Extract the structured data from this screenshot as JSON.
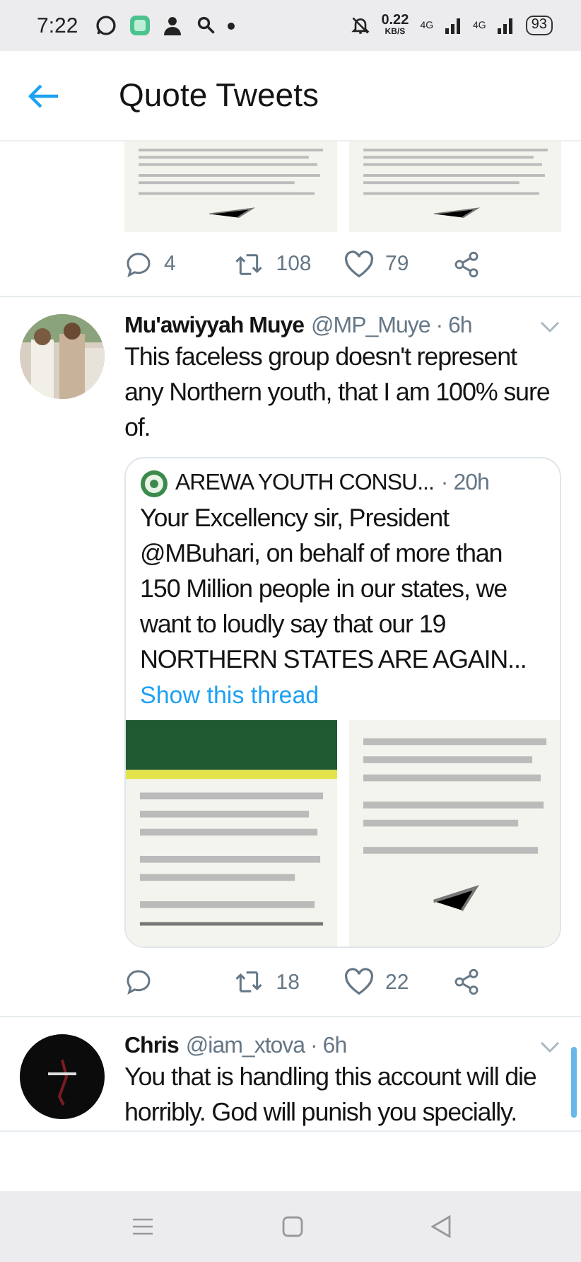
{
  "status_bar": {
    "time": "7:22",
    "speed": "0.22",
    "speed_unit": "KB/S",
    "networks": [
      "4G",
      "4G"
    ],
    "battery": "93"
  },
  "header": {
    "title": "Quote Tweets"
  },
  "tweets": [
    {
      "kind": "partial",
      "actions": {
        "replies": "4",
        "retweets": "108",
        "likes": "79"
      }
    },
    {
      "kind": "full",
      "name": "Mu'awiyyah Muye",
      "handle": "@MP_Muye",
      "time": "· 6h",
      "text": "This faceless group doesn't represent any Northern youth, that I am 100% sure of.",
      "quote": {
        "name": "AREWA YOUTH CONSU...",
        "time": "· 20h",
        "text": "Your Excellency sir, President @MBuhari, on behalf of more than 150 Million people in our states, we want to loudly say that our 19 NORTHERN STATES ARE AGAIN...",
        "link": "Show this thread"
      },
      "actions": {
        "retweets": "18",
        "likes": "22"
      }
    },
    {
      "kind": "full",
      "name": "Chris",
      "handle": "@iam_xtova",
      "time": "· 6h",
      "text": "You that is handling this account will die horribly. God will punish you specially."
    }
  ]
}
